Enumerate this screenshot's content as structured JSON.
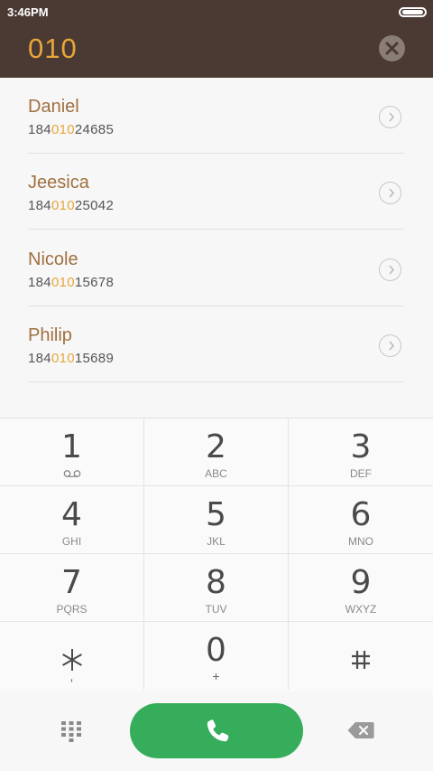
{
  "status_bar": {
    "time": "3:46PM"
  },
  "header": {
    "dialed_number": "010"
  },
  "colors": {
    "header_bg": "#4a3a33",
    "accent": "#e8a63a",
    "name": "#a0703f",
    "call_green": "#35ad5a"
  },
  "contacts": [
    {
      "name": "Daniel",
      "number_prefix": "184",
      "number_match": "010",
      "number_suffix": "24685"
    },
    {
      "name": "Jeesica",
      "number_prefix": "184",
      "number_match": "010",
      "number_suffix": "25042"
    },
    {
      "name": "Nicole",
      "number_prefix": "184",
      "number_match": "010",
      "number_suffix": "15678"
    },
    {
      "name": "Philip",
      "number_prefix": "184",
      "number_match": "010",
      "number_suffix": "15689"
    }
  ],
  "keypad": {
    "keys": [
      {
        "digit": "1",
        "letters": "",
        "icon": "voicemail-icon"
      },
      {
        "digit": "2",
        "letters": "ABC"
      },
      {
        "digit": "3",
        "letters": "DEF"
      },
      {
        "digit": "4",
        "letters": "GHI"
      },
      {
        "digit": "5",
        "letters": "JKL"
      },
      {
        "digit": "6",
        "letters": "MNO"
      },
      {
        "digit": "7",
        "letters": "PQRS"
      },
      {
        "digit": "8",
        "letters": "TUV"
      },
      {
        "digit": "9",
        "letters": "WXYZ"
      },
      {
        "digit": "*",
        "letters": ",",
        "icon": "asterisk-icon"
      },
      {
        "digit": "0",
        "letters": "+"
      },
      {
        "digit": "#",
        "letters": "",
        "icon": "hash-icon"
      }
    ]
  },
  "bottom_bar": {
    "left_icon": "keypad-grid-icon",
    "center_icon": "phone-handset-icon",
    "right_icon": "backspace-icon"
  }
}
